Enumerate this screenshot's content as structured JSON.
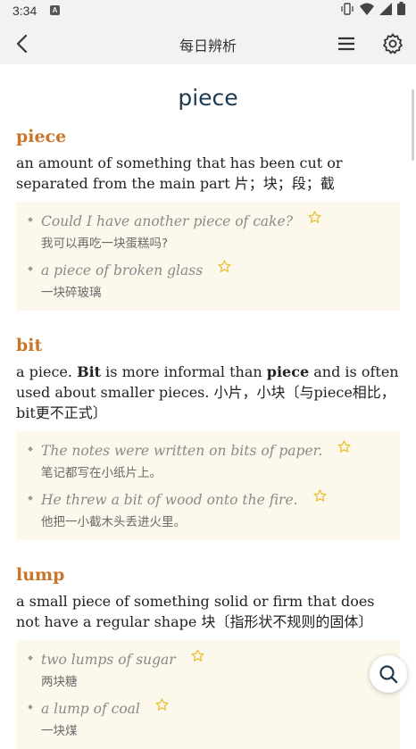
{
  "status_bar": {
    "time": "3:34",
    "notification_icon": "a-icon",
    "icons": [
      "vibrate-icon",
      "wifi-icon",
      "signal-icon",
      "battery-icon"
    ]
  },
  "top_bar": {
    "title": "每日辨析",
    "back_icon": "chevron-left-icon",
    "menu_icon": "menu-icon",
    "settings_icon": "gear-icon"
  },
  "headword": "piece",
  "entries": [
    {
      "term": "piece",
      "definition_parts": [
        {
          "text": "an amount of something that has been cut or separated from the main part 片；块；段；截",
          "bold": false
        }
      ],
      "examples": [
        {
          "en": "Could I have another piece of cake?",
          "zh": "我可以再吃一块蛋糕吗?"
        },
        {
          "en": "a piece of broken glass",
          "zh": "一块碎玻璃"
        }
      ]
    },
    {
      "term": "bit",
      "definition_parts": [
        {
          "text": "a piece. ",
          "bold": false
        },
        {
          "text": "Bit",
          "bold": true
        },
        {
          "text": " is more informal than ",
          "bold": false
        },
        {
          "text": "piece",
          "bold": true
        },
        {
          "text": " and is often used about smaller pieces. 小片，小块〔与piece相比，bit更不正式〕",
          "bold": false
        }
      ],
      "examples": [
        {
          "en": "The notes were written on bits of paper.",
          "zh": "笔记都写在小纸片上。"
        },
        {
          "en": "He threw a bit of wood onto the fire.",
          "zh": "他把一小截木头丢进火里。"
        }
      ]
    },
    {
      "term": "lump",
      "definition_parts": [
        {
          "text": "a small piece of something solid or firm that does not have a regular shape 块〔指形状不规则的固体〕",
          "bold": false
        }
      ],
      "examples": [
        {
          "en": "two lumps of sugar",
          "zh": "两块糖"
        },
        {
          "en": "a lump of coal",
          "zh": "一块煤"
        }
      ]
    }
  ],
  "floating_button": {
    "icon": "search-icon"
  },
  "colors": {
    "term": "#c8762a",
    "headword": "#1e3a52",
    "example_bg": "#fdf8ec",
    "star": "#e8c33a",
    "bar_bg": "#f2f2f2"
  }
}
